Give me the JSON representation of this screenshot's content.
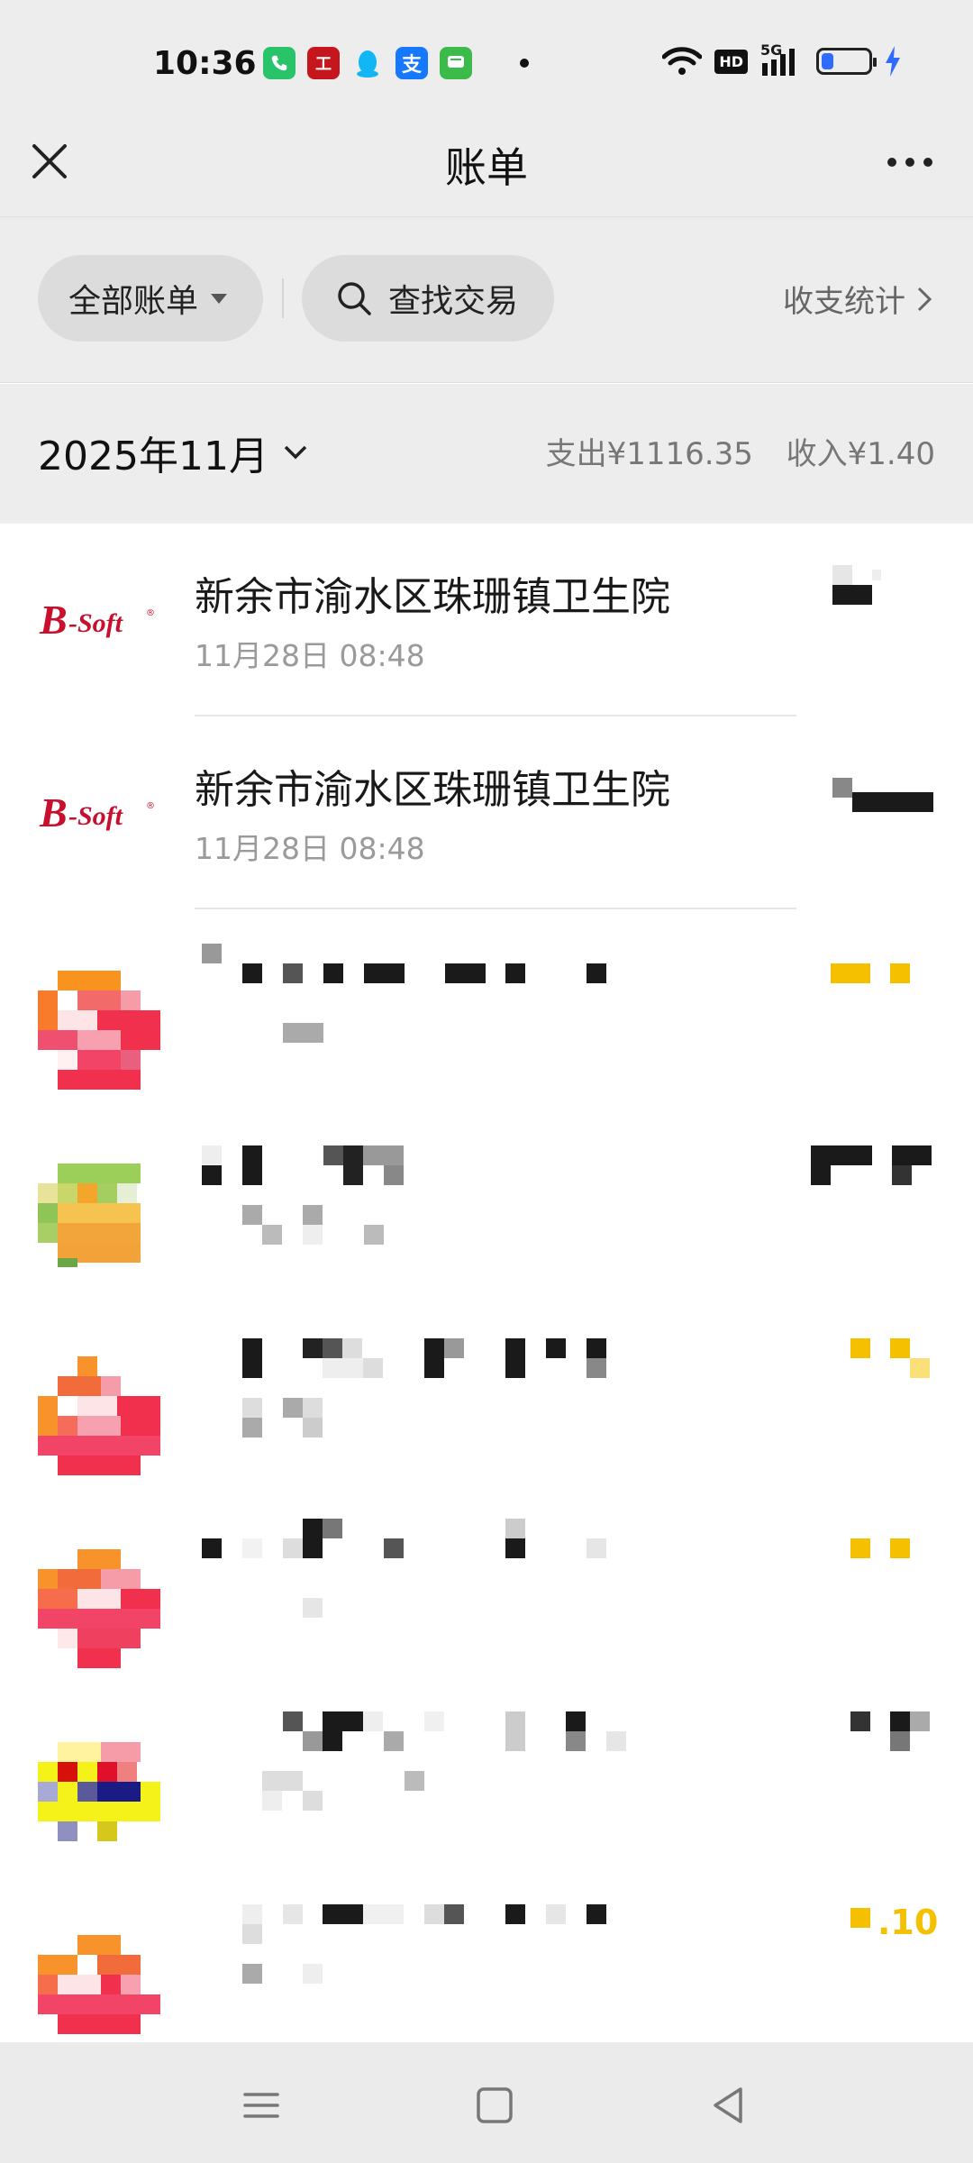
{
  "status_bar": {
    "time": "10:36",
    "network": "5G",
    "hd_label": "HD",
    "battery_level": 0.25,
    "icons": [
      "phone-icon",
      "bank-icon",
      "qq-icon",
      "alipay-icon",
      "message-icon",
      "wifi-icon",
      "signal-icon",
      "battery-icon",
      "charging-icon"
    ],
    "alipay_glyph": "支",
    "bank_glyph": "工"
  },
  "header": {
    "title": "账单",
    "close_icon": "close-icon",
    "more_icon": "more-icon"
  },
  "filter": {
    "all_bills_label": "全部账单",
    "search_label": "查找交易",
    "stats_label": "收支统计"
  },
  "month_bar": {
    "month_label": "2025年11月",
    "expense_label": "支出¥1116.35",
    "income_label": "收入¥1.40"
  },
  "transactions": [
    {
      "name": "新余市渝水区珠珊镇卫生院",
      "date": "11月28日 08:48",
      "logo_text": "B-Soft",
      "amount_redacted": true
    },
    {
      "name": "新余市渝水区珠珊镇卫生院",
      "date": "11月28日 08:48",
      "logo_text": "B-Soft",
      "amount_redacted": true
    },
    {
      "name_redacted": true,
      "amount_redacted": true,
      "amount_color": "#f5c000"
    },
    {
      "name_redacted": true,
      "amount_redacted": true
    },
    {
      "name_redacted": true,
      "amount_redacted": true,
      "amount_color": "#f5c000"
    },
    {
      "name_redacted": true,
      "amount_redacted": true,
      "amount_color": "#f5c000"
    },
    {
      "name_redacted": true,
      "amount_redacted": true
    },
    {
      "name_redacted": true,
      "amount_partial": ".10",
      "amount_color": "#f5c000"
    }
  ],
  "colors": {
    "page_bg": "#ededed",
    "list_bg": "#ffffff",
    "income_accent": "#f5c000",
    "logo_red": "#c8102e"
  },
  "nav_bar": [
    "menu-icon",
    "home-icon",
    "back-icon"
  ]
}
